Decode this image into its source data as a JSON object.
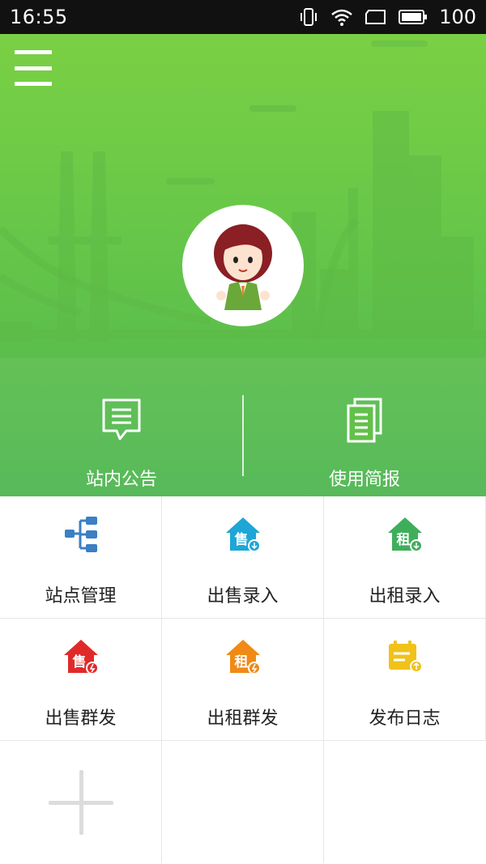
{
  "status_bar": {
    "time": "16:55",
    "battery": "100",
    "icons": [
      "vibrate-icon",
      "wifi-icon",
      "screen-icon",
      "battery-icon"
    ]
  },
  "header": {
    "menu_icon": "hamburger-menu-icon",
    "avatar_icon": "cartoon-agent-avatar",
    "background_color": "#6cc84a"
  },
  "quick_actions": [
    {
      "label": "站内公告",
      "icon": "message-document-icon"
    },
    {
      "label": "使用简报",
      "icon": "report-document-icon"
    }
  ],
  "grid": {
    "items": [
      {
        "label": "站点管理",
        "icon": "site-tree-icon",
        "color": "#3b7fc4"
      },
      {
        "label": "出售录入",
        "icon": "sale-house-icon",
        "badge": "售",
        "color": "#1ea6d6"
      },
      {
        "label": "出租录入",
        "icon": "rent-house-icon",
        "badge": "租",
        "color": "#3fae5b"
      },
      {
        "label": "出售群发",
        "icon": "sale-broadcast-icon",
        "badge": "售",
        "color": "#e02a2a"
      },
      {
        "label": "出租群发",
        "icon": "rent-broadcast-icon",
        "badge": "租",
        "color": "#f08a16"
      },
      {
        "label": "发布日志",
        "icon": "publish-log-icon",
        "color": "#f0c21a"
      }
    ],
    "add_icon": "add-plus-icon"
  }
}
